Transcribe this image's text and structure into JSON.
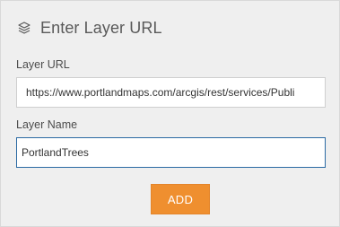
{
  "header": {
    "icon": "layers-icon",
    "title": "Enter Layer URL"
  },
  "form": {
    "url": {
      "label": "Layer URL",
      "value": "https://www.portlandmaps.com/arcgis/rest/services/Publi"
    },
    "name": {
      "label": "Layer Name",
      "value": "PortlandTrees"
    },
    "add_label": "ADD"
  },
  "colors": {
    "panel_background": "#efefef",
    "accent_button": "#ef8f2f",
    "focused_border": "#2b6aa3"
  }
}
